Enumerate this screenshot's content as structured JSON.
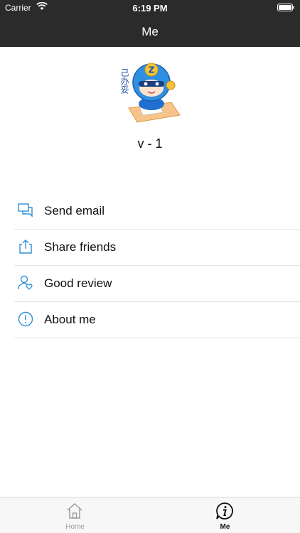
{
  "status_bar": {
    "carrier": "Carrier",
    "time": "6:19 PM",
    "wifi_icon": "wifi-icon",
    "battery_icon": "battery-icon"
  },
  "nav": {
    "title": "Me"
  },
  "profile": {
    "avatar_icon": "mascot-avatar",
    "logo_text": "己办妥",
    "version": "v - 1"
  },
  "menu": {
    "items": [
      {
        "label": "Send email",
        "icon": "chat-bubbles-icon"
      },
      {
        "label": "Share friends",
        "icon": "share-icon"
      },
      {
        "label": "Good review",
        "icon": "user-heart-icon"
      },
      {
        "label": "About me",
        "icon": "info-circle-icon"
      }
    ]
  },
  "tabs": [
    {
      "label": "Home",
      "icon": "home-icon",
      "selected": false
    },
    {
      "label": "Me",
      "icon": "info-bubble-icon",
      "selected": true
    }
  ],
  "colors": {
    "header_bg": "#2b2b2b",
    "icon_blue": "#2f8fd8",
    "divider": "#e2e2e2",
    "tab_inactive": "#9a9a9a"
  }
}
